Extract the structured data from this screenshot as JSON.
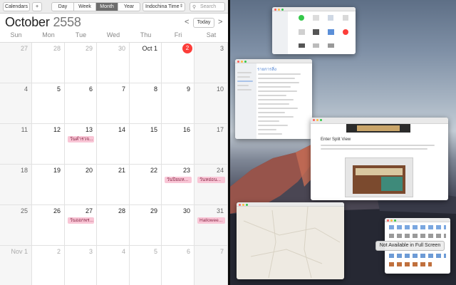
{
  "toolbar": {
    "calendars_label": "Calendars",
    "add_label": "+",
    "views": [
      "Day",
      "Week",
      "Month",
      "Year"
    ],
    "active_view": "Month",
    "timezone": "Indochina Time",
    "search_placeholder": "Search"
  },
  "header": {
    "month": "October",
    "year": "2558",
    "prev": "<",
    "next": ">",
    "today_label": "Today"
  },
  "weekdays": [
    "Sun",
    "Mon",
    "Tue",
    "Wed",
    "Thu",
    "Fri",
    "Sat"
  ],
  "weeks": [
    [
      {
        "d": "27",
        "o": true
      },
      {
        "d": "28",
        "o": true
      },
      {
        "d": "29",
        "o": true
      },
      {
        "d": "30",
        "o": true
      },
      {
        "d": "Oct 1"
      },
      {
        "d": "2",
        "today": true
      },
      {
        "d": "3"
      }
    ],
    [
      {
        "d": "4"
      },
      {
        "d": "5"
      },
      {
        "d": "6"
      },
      {
        "d": "7"
      },
      {
        "d": "8"
      },
      {
        "d": "9"
      },
      {
        "d": "10"
      }
    ],
    [
      {
        "d": "11"
      },
      {
        "d": "12"
      },
      {
        "d": "13",
        "event": "วันคำรวจ..."
      },
      {
        "d": "14"
      },
      {
        "d": "15"
      },
      {
        "d": "16"
      },
      {
        "d": "17"
      }
    ],
    [
      {
        "d": "18"
      },
      {
        "d": "19"
      },
      {
        "d": "20"
      },
      {
        "d": "21"
      },
      {
        "d": "22"
      },
      {
        "d": "23",
        "event": "วันปิยมห..."
      },
      {
        "d": "24",
        "event": "วันหย่อน..."
      }
    ],
    [
      {
        "d": "25"
      },
      {
        "d": "26"
      },
      {
        "d": "27",
        "event": "วันออกพร..."
      },
      {
        "d": "28"
      },
      {
        "d": "29"
      },
      {
        "d": "30"
      },
      {
        "d": "31",
        "event": "Hallowee..."
      }
    ],
    [
      {
        "d": "Nov 1",
        "o": true
      },
      {
        "d": "2",
        "o": true
      },
      {
        "d": "3",
        "o": true
      },
      {
        "d": "4",
        "o": true
      },
      {
        "d": "5",
        "o": true
      },
      {
        "d": "6",
        "o": true
      },
      {
        "d": "7",
        "o": true
      }
    ]
  ],
  "colors": {
    "today": "#fc3d39",
    "event_bg": "#f9c6d6",
    "event_text": "#8a2b4a"
  },
  "desktop": {
    "finder_sidebar_title": "รายการสิ่ง",
    "notes_title": "Enter Split View",
    "full_screen_tip": "Not Available in Full Screen"
  }
}
